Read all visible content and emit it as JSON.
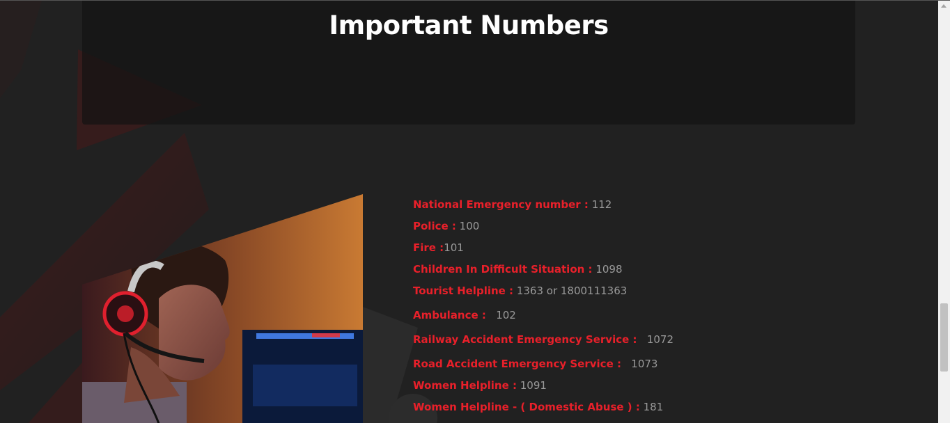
{
  "page": {
    "title": "Important Numbers"
  },
  "colors": {
    "background": "#212121",
    "accent": "#e8202a",
    "value_text": "#9a9a9a",
    "title_text": "#ffffff"
  },
  "numbers": [
    {
      "label": "National Emergency number :",
      "value": "112"
    },
    {
      "label": "Police :",
      "value": "100"
    },
    {
      "label": "Fire :",
      "value": "101"
    },
    {
      "label": "Children In Difficult Situation :",
      "value": "1098"
    },
    {
      "label": "Tourist Helpline :",
      "value": "1363 or 1800111363"
    },
    {
      "label": "Ambulance :",
      "value": "102"
    },
    {
      "label": "Railway Accident Emergency Service :",
      "value": "1072"
    },
    {
      "label": "Road Accident Emergency Service :",
      "value": "1073"
    },
    {
      "label": "Women Helpline :",
      "value": "1091"
    },
    {
      "label": "Women Helpline - ( Domestic Abuse ) :",
      "value": "181"
    }
  ],
  "icons": {
    "photo": "headset-operator-photo",
    "scroll_up": "chevron-up-icon"
  }
}
